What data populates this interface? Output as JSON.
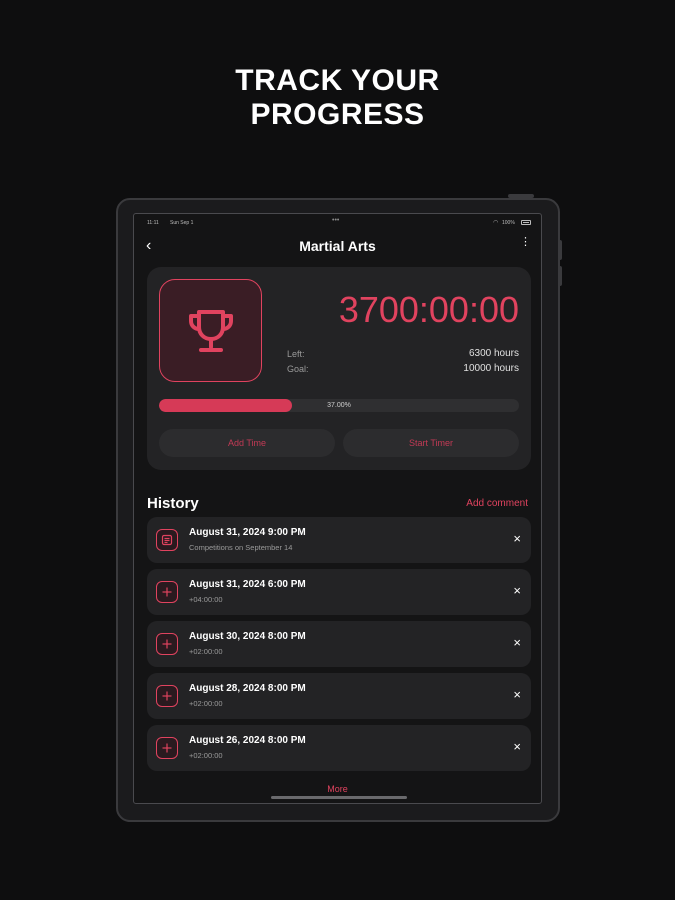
{
  "headline": {
    "line1": "TRACK YOUR",
    "line2": "PROGRESS"
  },
  "statusbar": {
    "time": "11:11",
    "date": "Sun Sep 1",
    "battery": "100%"
  },
  "nav": {
    "back": "‹",
    "title": "Martial Arts",
    "more": "⋮"
  },
  "card": {
    "timer": "3700:00:00",
    "left_label": "Left:",
    "left_value": "6300 hours",
    "goal_label": "Goal:",
    "goal_value": "10000 hours",
    "progress_text": "37.00%",
    "progress_fraction": 0.37,
    "add_time_label": "Add Time",
    "start_timer_label": "Start Timer"
  },
  "history": {
    "title": "History",
    "add_comment": "Add comment",
    "items": [
      {
        "title": "August 31, 2024 9:00 PM",
        "sub": "Competitions on September 14",
        "icon": "note-icon"
      },
      {
        "title": "August 31, 2024 6:00 PM",
        "sub": "+04:00:00",
        "icon": "plus-icon"
      },
      {
        "title": "August 30, 2024 8:00 PM",
        "sub": "+02:00:00",
        "icon": "plus-icon"
      },
      {
        "title": "August 28, 2024 8:00 PM",
        "sub": "+02:00:00",
        "icon": "plus-icon"
      },
      {
        "title": "August 26, 2024 8:00 PM",
        "sub": "+02:00:00",
        "icon": "plus-icon"
      }
    ],
    "close_glyph": "×",
    "more": "More"
  },
  "colors": {
    "accent": "#e0435f",
    "background": "#0e0e0f",
    "card": "#232325"
  }
}
